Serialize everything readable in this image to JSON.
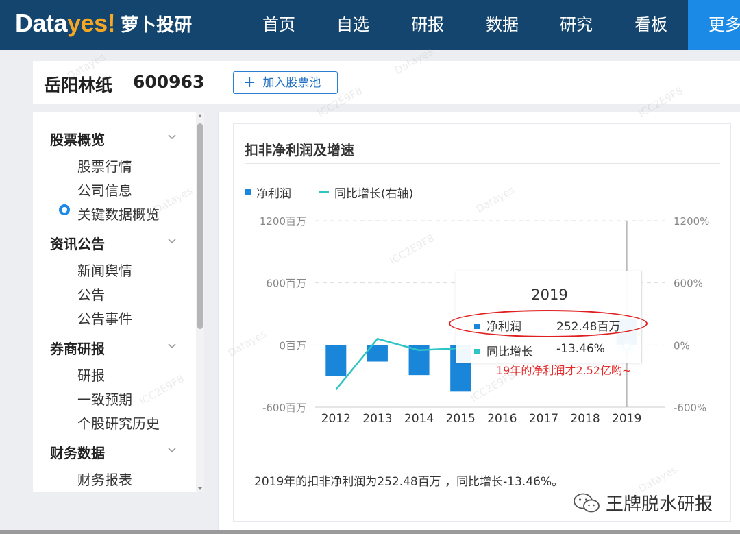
{
  "app": {
    "logo_data": "Data",
    "logo_yes": "yes!",
    "logo_cn": "萝卜投研"
  },
  "nav": {
    "items": [
      "首页",
      "自选",
      "研报",
      "数据",
      "研究",
      "看板"
    ],
    "more": "更多"
  },
  "stock": {
    "name": "岳阳林纸",
    "code": "600963",
    "add_button": "加入股票池"
  },
  "sidebar": {
    "groups": [
      {
        "label": "股票概览",
        "items": [
          "股票行情",
          "公司信息",
          "关键数据概览"
        ]
      },
      {
        "label": "资讯公告",
        "items": [
          "新闻舆情",
          "公告",
          "公告事件"
        ]
      },
      {
        "label": "券商研报",
        "items": [
          "研报",
          "一致预期",
          "个股研究历史"
        ]
      },
      {
        "label": "财务数据",
        "items": [
          "财务报表"
        ]
      }
    ],
    "active_item": "关键数据概览"
  },
  "card": {
    "title": "扣非净利润及增速",
    "summary": "2019年的扣非净利润为252.48百万 ，同比增长-13.46%。"
  },
  "chart_data": {
    "type": "bar",
    "categories": [
      "2012",
      "2013",
      "2014",
      "2015",
      "2016",
      "2017",
      "2018",
      "2019"
    ],
    "series": [
      {
        "name": "净利润",
        "type": "bar",
        "axis": "left",
        "values": [
          -300,
          -160,
          -290,
          -450,
          null,
          null,
          null,
          252.48
        ]
      },
      {
        "name": "同比增长(右轴)",
        "type": "line",
        "axis": "right",
        "values": [
          -430,
          60,
          -50,
          -30,
          null,
          null,
          null,
          -13.46
        ]
      }
    ],
    "y_left": {
      "ylim": [
        -600,
        1200
      ],
      "ticks": [
        "1200百万",
        "600百万",
        "0百万",
        "-600百万"
      ]
    },
    "y_right": {
      "ylim": [
        -600,
        1200
      ],
      "ticks": [
        "1200%",
        "600%",
        "0%",
        "-600%"
      ]
    },
    "grid": true,
    "legend_placement": "top-left",
    "colors": {
      "bar": "#1a86d9",
      "line": "#2ec4c6"
    }
  },
  "tooltip": {
    "year": "2019",
    "rows": [
      {
        "label": "净利润",
        "value": "252.48百万",
        "color": "#1a86d9"
      },
      {
        "label": "同比增长",
        "value": "-13.46%",
        "color": "#2ec4c6"
      }
    ]
  },
  "annotation": "19年的净利润才2.52亿哟~",
  "watermarks": [
    "Datayes",
    "ICC2E9F8"
  ],
  "brand": {
    "wechat_name": "王牌脱水研报",
    "icon": "wechat-icon"
  }
}
